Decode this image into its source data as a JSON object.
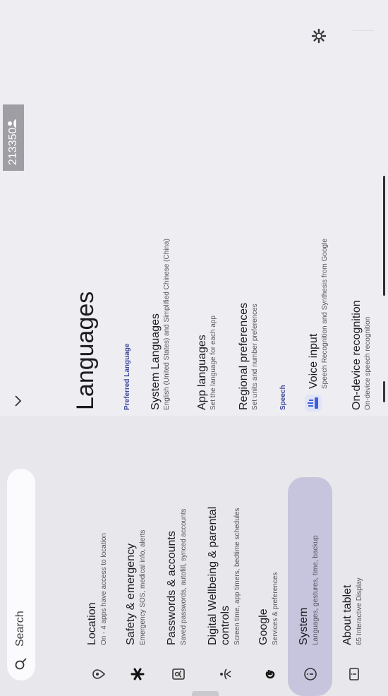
{
  "search": {
    "label": "Search"
  },
  "settings_list": [
    {
      "title": "Location",
      "subtitle": "On - 4 apps have access to location",
      "icon": "location-icon"
    },
    {
      "title": "Safety & emergency",
      "subtitle": "Emergency SOS, medical info, alerts",
      "icon": "asterisk-icon"
    },
    {
      "title": "Passwords & accounts",
      "subtitle": "Saved passwords, autofill, synced accounts",
      "icon": "passwords-icon"
    },
    {
      "title": "Digital Wellbeing & parental",
      "title2": "controls",
      "subtitle": "Screen time, app timers, bedtime schedules",
      "icon": "wellbeing-icon"
    },
    {
      "title": "Google",
      "subtitle": "Services & preferences",
      "icon": "google-icon"
    },
    {
      "title": "System",
      "subtitle": "Languages, gestures, time, backup",
      "icon": "info-icon"
    },
    {
      "title": "About tablet",
      "subtitle": "65 Interactive Display",
      "icon": "tablet-icon"
    }
  ],
  "detail": {
    "page_title": "Languages",
    "section_preferred": "Preferred Language",
    "section_speech": "Speech",
    "items": [
      {
        "title": "System Languages",
        "subtitle": "English (United States) and Simplified Chinese (China)"
      },
      {
        "title": "App languages",
        "subtitle": "Set the language for each app"
      },
      {
        "title": "Regional preferences",
        "subtitle": "Set units and number preferences"
      },
      {
        "title": "Voice input",
        "subtitle": "Speech Recognition and Synthesis from Google"
      },
      {
        "title": "On-device recognition",
        "subtitle": "On-device speech recognition"
      }
    ]
  },
  "status_bar": {
    "time": "213350"
  },
  "colors": {
    "highlight": "#c6c5dd",
    "accent": "#3f4a9c"
  }
}
